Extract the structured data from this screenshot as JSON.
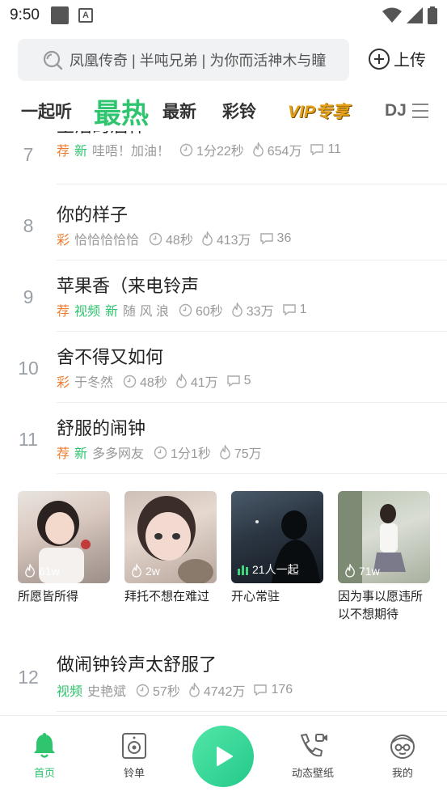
{
  "status_bar": {
    "time": "9:50"
  },
  "search": {
    "text": "凤凰传奇 | 半吨兄弟 | 为你而活神木与瞳"
  },
  "upload": {
    "label": "上传"
  },
  "tabs": [
    {
      "label": "一起听"
    },
    {
      "label": "最热"
    },
    {
      "label": "最新"
    },
    {
      "label": "彩铃"
    },
    {
      "label": "VIP专享"
    },
    {
      "label": "DJ"
    }
  ],
  "songs": [
    {
      "rank": "7",
      "title": "生活的酒杯",
      "tags": [
        "荐",
        "新"
      ],
      "artist": "哇唔！加油！",
      "duration": "1分22秒",
      "plays": "654万",
      "comments": "11"
    },
    {
      "rank": "8",
      "title": "你的样子",
      "tags": [
        "彩"
      ],
      "artist": "恰恰恰恰恰",
      "duration": "48秒",
      "plays": "413万",
      "comments": "36"
    },
    {
      "rank": "9",
      "title": "苹果香（来电铃声",
      "tags": [
        "荐",
        "视频",
        "新"
      ],
      "artist": "随 风 浪",
      "duration": "60秒",
      "plays": "33万",
      "comments": "1"
    },
    {
      "rank": "10",
      "title": "舍不得又如何",
      "tags": [
        "彩"
      ],
      "artist": "于冬然",
      "duration": "48秒",
      "plays": "41万",
      "comments": "5"
    },
    {
      "rank": "11",
      "title": "舒服的闹钟",
      "tags": [
        "荐",
        "新"
      ],
      "artist": "多多网友",
      "duration": "1分1秒",
      "plays": "75万",
      "comments": ""
    },
    {
      "rank": "12",
      "title": "做闹钟铃声太舒服了",
      "tags": [
        "视频"
      ],
      "artist": "史艳斌",
      "duration": "57秒",
      "plays": "4742万",
      "comments": "176"
    }
  ],
  "cards": [
    {
      "badge": "61w",
      "caption": "所愿皆所得"
    },
    {
      "badge": "2w",
      "caption": "拜托不想在难过"
    },
    {
      "badge": "21人一起",
      "caption": "开心常驻"
    },
    {
      "badge": "71w",
      "caption": "因为事以愿违所以不想期待"
    }
  ],
  "bottom_nav": [
    {
      "label": "首页"
    },
    {
      "label": "铃单"
    },
    {
      "label": "动态壁纸"
    },
    {
      "label": "我的"
    }
  ],
  "colors": {
    "accent": "#2ec56e",
    "tag_orange": "#f07a2c",
    "vip_gold": "#e3a21a"
  }
}
